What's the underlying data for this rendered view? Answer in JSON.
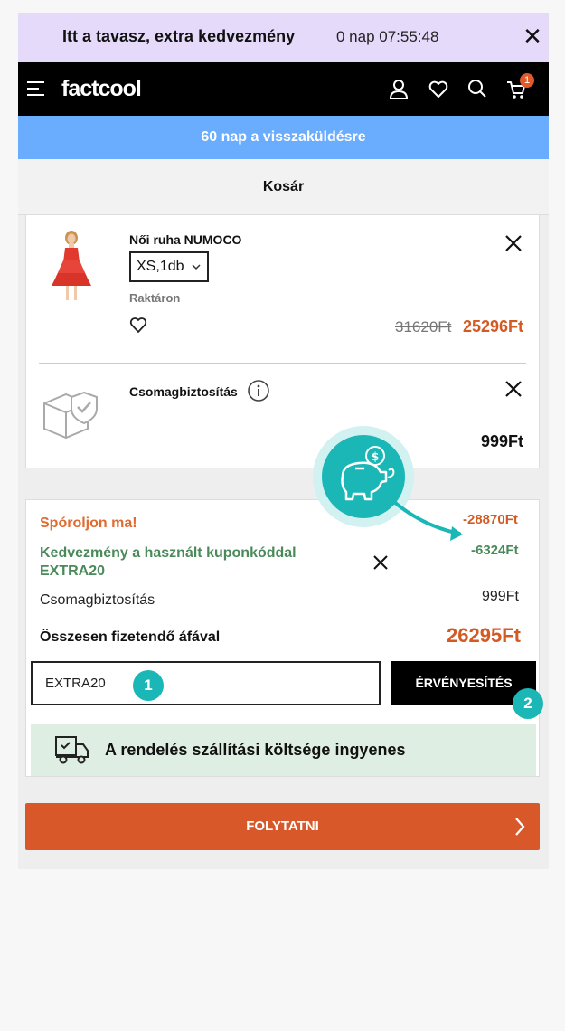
{
  "promo": {
    "link_text": "Itt a tavasz, extra kedvezmény",
    "timer": "0 nap 07:55:48",
    "close_glyph": "✕"
  },
  "header": {
    "logo": "factcool",
    "cart_count": "1"
  },
  "returns_banner": "60 nap a visszaküldésre",
  "page_title": "Kosár",
  "cart": {
    "product": {
      "name": "Női ruha NUMOCO",
      "variant": "XS,1db",
      "stock": "Raktáron",
      "old_price": "31620Ft",
      "new_price": "25296Ft"
    },
    "insurance": {
      "name": "Csomagbiztosítás",
      "price": "999Ft"
    }
  },
  "summary": {
    "save_label": "Spóroljon ma!",
    "save_value": "-28870Ft",
    "discount_label": "Kedvezmény a használt kuponkóddal EXTRA20",
    "discount_value": "-6324Ft",
    "insurance_label": "Csomagbiztosítás",
    "insurance_value": "999Ft",
    "total_label": "Összesen fizetendő áfával",
    "total_value": "26295Ft",
    "coupon_value": "EXTRA20",
    "apply_label": "ÉRVÉNYESÍTÉS",
    "free_shipping": "A rendelés szállítási költsége ingyenes"
  },
  "continue_label": "FOLYTATNI",
  "annotations": {
    "step1": "1",
    "step2": "2"
  },
  "colors": {
    "promo_bg": "#e6dafb",
    "header_bg": "#000000",
    "returns_bg": "#6aadff",
    "accent_orange": "#d9582a",
    "discount_green": "#4a8a5a",
    "free_ship_bg": "#deeee3",
    "annotation_teal": "#1bb6b6"
  },
  "icons": [
    "menu-icon",
    "user-icon",
    "heart-icon",
    "search-icon",
    "cart-icon",
    "close-icon",
    "chevron-down-icon",
    "info-icon",
    "shield-box-icon",
    "truck-icon",
    "chevron-right-icon",
    "piggy-bank-icon"
  ]
}
